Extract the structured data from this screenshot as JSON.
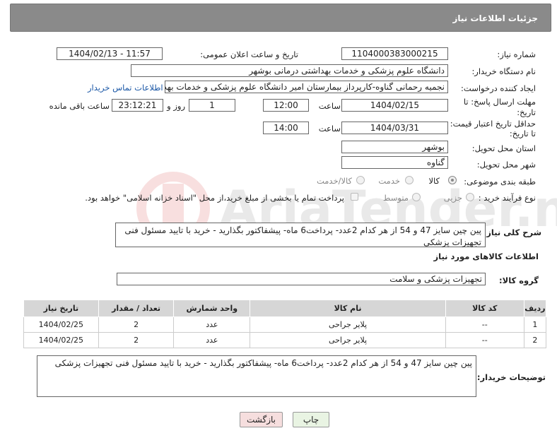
{
  "header": {
    "title": "جزئیات اطلاعات نیاز"
  },
  "fields": {
    "need_number_label": "شماره نیاز:",
    "need_number": "1104000383000215",
    "announce_label": "تاریخ و ساعت اعلان عمومی:",
    "announce_value": "1404/02/13 - 11:57",
    "buyer_org_label": "نام دستگاه خریدار:",
    "buyer_org": "دانشگاه علوم پزشکی و خدمات بهداشتی درمانی بوشهر",
    "creator_label": "ایجاد کننده درخواست:",
    "creator": "نجمیه رحمانی گناوه-کارپرداز بیمارستان امیر دانشگاه علوم پزشکی و خدمات بهد",
    "contact_link": "اطلاعات تماس خریدار",
    "deadline_label_1": "مهلت ارسال پاسخ: تا",
    "deadline_label_2": "تاریخ:",
    "deadline_date": "1404/02/15",
    "time_label": "ساعت",
    "deadline_time": "12:00",
    "days_value": "1",
    "days_label": "روز و",
    "remaining_time": "23:12:21",
    "remaining_label": "ساعت باقی مانده",
    "validity_label_1": "حداقل تاریخ اعتبار قیمت:",
    "validity_label_2": "تا تاریخ:",
    "validity_date": "1404/03/31",
    "validity_time": "14:00",
    "province_label": "استان محل تحویل:",
    "province": "بوشهر",
    "city_label": "شهر محل تحویل:",
    "city": "گناوه",
    "category_label": "طبقه بندی موضوعی:",
    "cat_goods": "کالا",
    "cat_service": "خدمت",
    "cat_goods_service": "کالا/خدمت",
    "process_label": "نوع فرآیند خرید :",
    "proc_partial": "جزیی",
    "proc_medium": "متوسط",
    "payment_note": "پرداخت تمام یا بخشی از مبلغ خرید،از محل \"اسناد خزانه اسلامی\" خواهد بود.",
    "desc_label": "شرح کلی نیاز:",
    "desc": "پین چین سایز 47 و 54 از هر کدام 2عدد- پرداخت6 ماه- پیشفاکتور بگذارید - خرید با تایید مسئول فنی تجهیزات پزشکی",
    "goods_info_title": "اطلاعات کالاهای مورد نیاز",
    "goods_group_label": "گروه کالا:",
    "goods_group": "تجهیزات پزشکی و سلامت",
    "buyer_notes_label": "توضیحات خریدار:",
    "buyer_notes": "پین چین سایز 47 و 54 از هر کدام 2عدد- پرداخت6 ماه- پیشفاکتور بگذارید - خرید با تایید مسئول فنی تجهیزات پزشکی"
  },
  "table": {
    "headers": {
      "row": "ردیف",
      "code": "کد کالا",
      "name": "نام کالا",
      "unit": "واحد شمارش",
      "qty": "تعداد / مقدار",
      "date": "تاریخ نیاز"
    },
    "rows": [
      {
        "row": "1",
        "code": "--",
        "name": "پلایر جراحی",
        "unit": "عدد",
        "qty": "2",
        "date": "1404/02/25"
      },
      {
        "row": "2",
        "code": "--",
        "name": "پلایر جراحی",
        "unit": "عدد",
        "qty": "2",
        "date": "1404/02/25"
      }
    ]
  },
  "buttons": {
    "print": "چاپ",
    "back": "بازگشت"
  },
  "colors": {
    "header_bg": "#8a8a8a",
    "link": "#1a57a6",
    "print_bg": "#e9f4e3",
    "back_bg": "#f6dede"
  }
}
